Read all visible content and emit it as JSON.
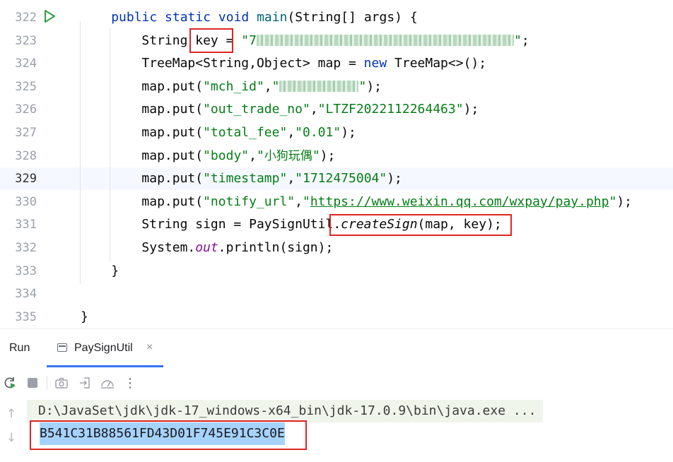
{
  "editor": {
    "current_line": "329",
    "lines": [
      {
        "num": "322",
        "indent": "    ",
        "parts": [
          {
            "t": "public ",
            "c": "kw"
          },
          {
            "t": "static ",
            "c": "kw"
          },
          {
            "t": "void ",
            "c": "kw"
          },
          {
            "t": "main",
            "c": "fn"
          },
          {
            "t": "(String[] args) {",
            "c": ""
          }
        ]
      },
      {
        "num": "323",
        "indent": "        ",
        "parts": [
          {
            "t": "String ",
            "c": ""
          },
          {
            "t": "key",
            "c": ""
          },
          {
            "t": " = ",
            "c": ""
          },
          {
            "t": "\"7",
            "c": "str"
          },
          {
            "t": "",
            "c": "blur",
            "n": 26
          },
          {
            "t": "\"",
            "c": "str"
          },
          {
            "t": ";",
            "c": ""
          }
        ]
      },
      {
        "num": "324",
        "indent": "        ",
        "parts": [
          {
            "t": "TreeMap<String,Object> map = ",
            "c": ""
          },
          {
            "t": "new ",
            "c": "kw"
          },
          {
            "t": "TreeMap<>();",
            "c": ""
          }
        ]
      },
      {
        "num": "325",
        "indent": "        ",
        "parts": [
          {
            "t": "map.put(",
            "c": ""
          },
          {
            "t": "\"mch_id\"",
            "c": "str"
          },
          {
            "t": ",",
            "c": ""
          },
          {
            "t": "\"",
            "c": "str"
          },
          {
            "t": "",
            "c": "blur",
            "n": 8
          },
          {
            "t": "\"",
            "c": "str"
          },
          {
            "t": ");",
            "c": ""
          }
        ]
      },
      {
        "num": "326",
        "indent": "        ",
        "parts": [
          {
            "t": "map.put(",
            "c": ""
          },
          {
            "t": "\"out_trade_no\"",
            "c": "str"
          },
          {
            "t": ",",
            "c": ""
          },
          {
            "t": "\"LTZF2022112264463\"",
            "c": "str"
          },
          {
            "t": ");",
            "c": ""
          }
        ]
      },
      {
        "num": "327",
        "indent": "        ",
        "parts": [
          {
            "t": "map.put(",
            "c": ""
          },
          {
            "t": "\"total_fee\"",
            "c": "str"
          },
          {
            "t": ",",
            "c": ""
          },
          {
            "t": "\"0.01\"",
            "c": "str"
          },
          {
            "t": ");",
            "c": ""
          }
        ]
      },
      {
        "num": "328",
        "indent": "        ",
        "parts": [
          {
            "t": "map.put(",
            "c": ""
          },
          {
            "t": "\"body\"",
            "c": "str"
          },
          {
            "t": ",",
            "c": ""
          },
          {
            "t": "\"",
            "c": "str"
          },
          {
            "t": "小狗玩偶",
            "c": "str cn"
          },
          {
            "t": "\"",
            "c": "str"
          },
          {
            "t": ");",
            "c": ""
          }
        ]
      },
      {
        "num": "329",
        "indent": "        ",
        "parts": [
          {
            "t": "map.put(",
            "c": ""
          },
          {
            "t": "\"timestamp\"",
            "c": "str"
          },
          {
            "t": ",",
            "c": ""
          },
          {
            "t": "\"1712475004\"",
            "c": "str"
          },
          {
            "t": ");",
            "c": ""
          }
        ]
      },
      {
        "num": "330",
        "indent": "        ",
        "parts": [
          {
            "t": "map.put(",
            "c": ""
          },
          {
            "t": "\"notify_url\"",
            "c": "str"
          },
          {
            "t": ",",
            "c": ""
          },
          {
            "t": "\"",
            "c": "str"
          },
          {
            "t": "https://www.weixin.qq.com/wxpay/pay.php",
            "c": "str url"
          },
          {
            "t": "\"",
            "c": "str"
          },
          {
            "t": ");",
            "c": ""
          }
        ]
      },
      {
        "num": "331",
        "indent": "        ",
        "parts": [
          {
            "t": "String sign = PaySignUtil.",
            "c": ""
          },
          {
            "t": "createSign",
            "c": "it"
          },
          {
            "t": "(map, key);",
            "c": ""
          }
        ]
      },
      {
        "num": "332",
        "indent": "        ",
        "parts": [
          {
            "t": "System.",
            "c": ""
          },
          {
            "t": "out",
            "c": "stc"
          },
          {
            "t": ".println(sign);",
            "c": ""
          }
        ]
      },
      {
        "num": "333",
        "indent": "    ",
        "parts": [
          {
            "t": "}",
            "c": ""
          }
        ]
      },
      {
        "num": "334",
        "indent": "",
        "parts": []
      },
      {
        "num": "335",
        "indent": "",
        "parts": [
          {
            "t": "}",
            "c": ""
          }
        ]
      }
    ]
  },
  "run_panel": {
    "title": "Run",
    "tab_label": "PaySignUtil",
    "tab_close": "×",
    "toolbar": {
      "rerun": "rerun-icon",
      "stop": "stop-icon",
      "screenshot": "camera-icon",
      "export": "export-icon",
      "profiler": "gauge-icon",
      "more": "⋮"
    },
    "console": {
      "command": "D:\\JavaSet\\jdk\\jdk-17_windows-x64_bin\\jdk-17.0.9\\bin\\java.exe ...",
      "output": "B541C31B88561FD43D01F745E91C3C0E"
    },
    "scroll_up": "↑",
    "scroll_down": "↓"
  },
  "colors": {
    "keyword": "#0033b3",
    "function": "#00627a",
    "string": "#067d17",
    "static_field": "#871094",
    "annotation_box": "#e02424",
    "selection": "#a6d2ff",
    "tab_underline": "#3574f0"
  }
}
